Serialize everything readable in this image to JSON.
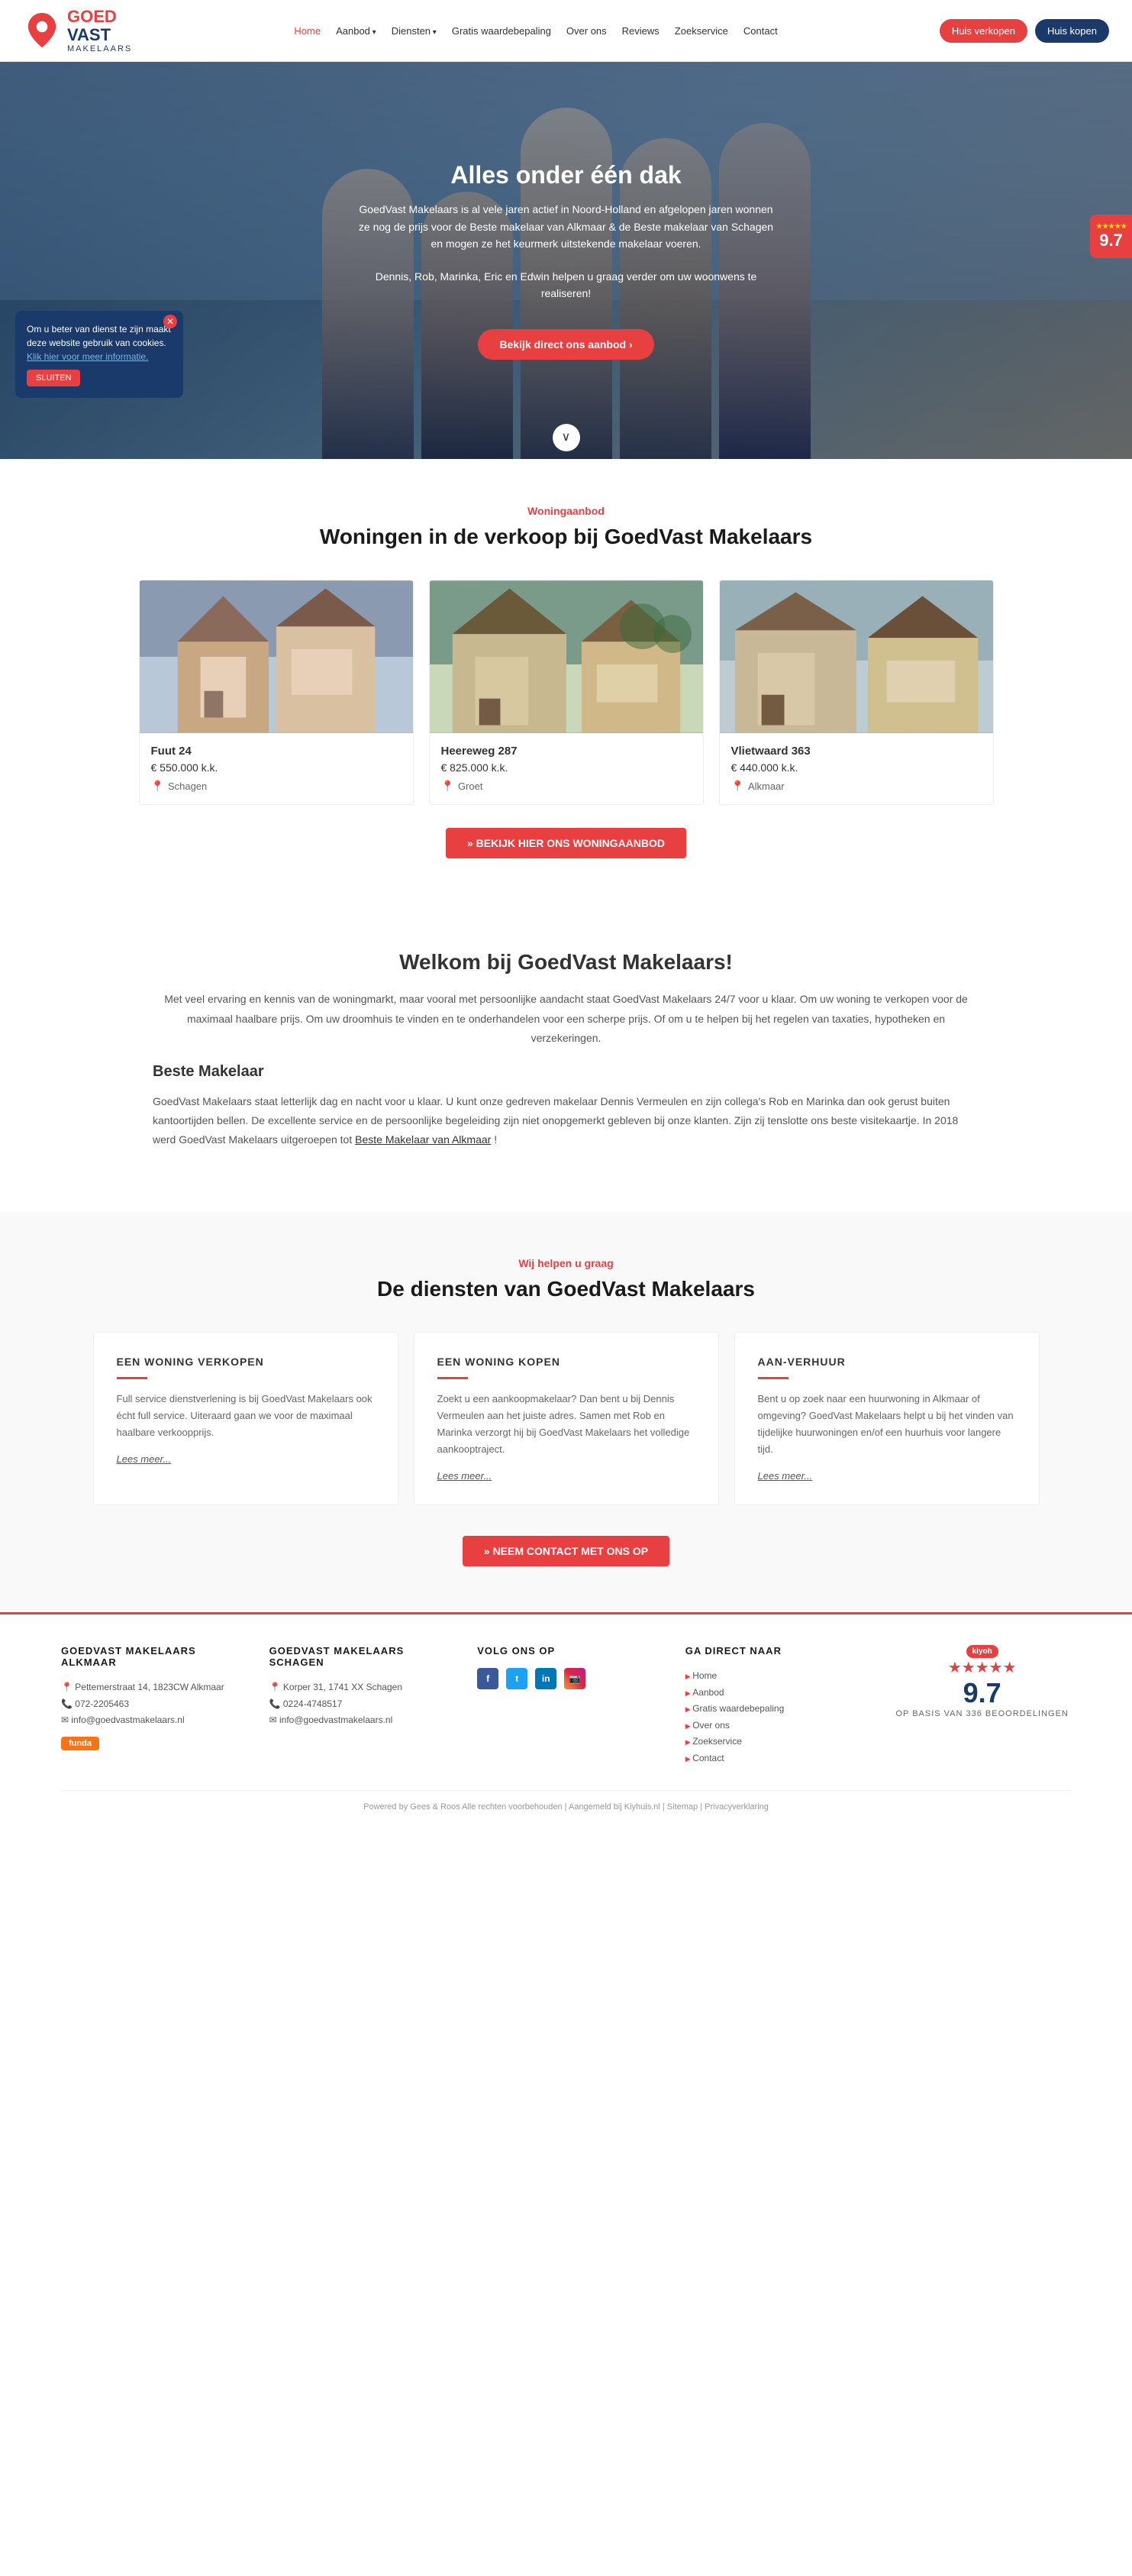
{
  "header": {
    "logo": {
      "goed": "GOED",
      "vast": "VAST",
      "makelaars": "MAKELAARS"
    },
    "nav": [
      {
        "label": "Home",
        "active": true
      },
      {
        "label": "Aanbod",
        "dropdown": true
      },
      {
        "label": "Diensten",
        "dropdown": true
      },
      {
        "label": "Gratis waardebepaling"
      },
      {
        "label": "Over ons"
      },
      {
        "label": "Reviews"
      },
      {
        "label": "Zoekservice"
      },
      {
        "label": "Contact"
      }
    ],
    "btn_verkopen": "Huis verkopen",
    "btn_kopen": "Huis kopen"
  },
  "hero": {
    "title": "Alles onder één dak",
    "text": "GoedVast Makelaars is al vele jaren actief in Noord-Holland en afgelopen jaren wonnen ze nog de prijs voor de Beste makelaar van Alkmaar & de Beste makelaar van Schagen en mogen ze het keurmerk uitstekende makelaar voeren.",
    "subtext": "Dennis, Rob, Marinka, Eric en Edwin helpen u graag verder om uw woonwens te realiseren!",
    "btn": "Bekijk direct ons aanbod ›",
    "rating": "9.7",
    "cookie_text": "Om u beter van dienst te zijn maakt deze website gebruik van cookies.",
    "cookie_link": "Klik hier voor meer informatie.",
    "cookie_btn": "SLUITEN"
  },
  "woningaanbod": {
    "label": "Woningaanbod",
    "title": "Woningen in de verkoop bij GoedVast Makelaars",
    "properties": [
      {
        "name": "Fuut 24",
        "price": "€ 550.000 k.k.",
        "location": "Schagen"
      },
      {
        "name": "Heereweg 287",
        "price": "€ 825.000 k.k.",
        "location": "Groet"
      },
      {
        "name": "Vlietwaard 363",
        "price": "€ 440.000 k.k.",
        "location": "Alkmaar"
      }
    ],
    "btn": "» BEKIJK HIER ONS WONINGAANBOD"
  },
  "welkom": {
    "title": "Welkom bij GoedVast Makelaars!",
    "intro": "Met veel ervaring en kennis van de woningmarkt, maar vooral met persoonlijke aandacht staat GoedVast Makelaars 24/7 voor u klaar. Om uw woning te verkopen voor de maximaal haalbare prijs. Om uw droomhuis te vinden en te onderhandelen voor een scherpe prijs. Of om u te helpen bij het regelen van taxaties, hypotheken en verzekeringen.",
    "beste_title": "Beste Makelaar",
    "beste_text": "GoedVast Makelaars staat letterlijk dag en nacht voor u klaar. U kunt onze gedreven makelaar Dennis Vermeulen en zijn collega's Rob en Marinka dan ook gerust buiten kantoortijden bellen. De excellente service en de persoonlijke begeleiding zijn niet onopgemerkt gebleven bij onze klanten. Zijn zij tenslotte ons beste visitekaartje. In 2018 werd GoedVast Makelaars uitgeroepen tot ",
    "beste_link": "Beste Makelaar van Alkmaar",
    "beste_end": "!"
  },
  "diensten": {
    "label": "Wij helpen u graag",
    "title": "De diensten van GoedVast Makelaars",
    "cards": [
      {
        "title": "EEN WONING VERKOPEN",
        "text": "Full service dienstverlening is bij GoedVast Makelaars ook écht full service. Uiteraard gaan we voor de maximaal haalbare verkoopprijs.",
        "link": "Lees meer..."
      },
      {
        "title": "EEN WONING KOPEN",
        "text": "Zoekt u een aankoopmakelaar? Dan bent u bij Dennis Vermeulen aan het juiste adres. Samen met Rob en Marinka verzorgt hij bij GoedVast Makelaars het volledige aankooptraject.",
        "link": "Lees meer..."
      },
      {
        "title": "AAN-VERHUUR",
        "text": "Bent u op zoek naar een huurwoning in Alkmaar of omgeving? GoedVast Makelaars helpt u bij het vinden van tijdelijke huurwoningen en/of een huurhuis voor langere tijd.",
        "link": "Lees meer..."
      }
    ],
    "btn": "» NEEM CONTACT MET ONS OP"
  },
  "footer": {
    "alkmaar": {
      "title": "GOEDVAST MAKELAARS ALKMAAR",
      "address": "Pettemerstraat 14, 1823CW Alkmaar",
      "phone": "072-2205463",
      "email": "info@goedvastmakelaars.nl"
    },
    "schagen": {
      "title": "GOEDVAST MAKELAARS SCHAGEN",
      "address": "Korper 31, 1741 XX Schagen",
      "phone": "0224-4748517",
      "email": "info@goedvastmakelaars.nl"
    },
    "volg": {
      "title": "VOLG ONS OP"
    },
    "ga_direct": {
      "title": "GA DIRECT NAAR",
      "links": [
        "Home",
        "Aanbod",
        "Gratis waardebepaling",
        "Over ons",
        "Zoekservice",
        "Contact"
      ]
    },
    "rating": {
      "score": "9.7",
      "stars": "★★★★★",
      "basis": "OP BASIS VAN 336 BEOORDELINGEN"
    },
    "bottom": "Powered by Gees & Roos Alle rechten voorbehouden | Aangemeld bij Kiyhuis.nl | Sitemap | Privacyverklaring"
  }
}
